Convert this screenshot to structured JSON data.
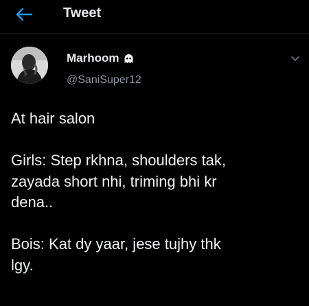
{
  "header": {
    "title": "Tweet"
  },
  "author": {
    "name": "Marhoom",
    "handle": "@SaniSuper12"
  },
  "tweet": {
    "line1": "At hair salon",
    "line2": "Girls: Step rkhna, shoulders tak,",
    "line3": "zayada short nhi, triming bhi kr",
    "line4": "dena..",
    "line5": "Bois: Kat dy yaar, jese tujhy thk",
    "line6": "lgy."
  }
}
